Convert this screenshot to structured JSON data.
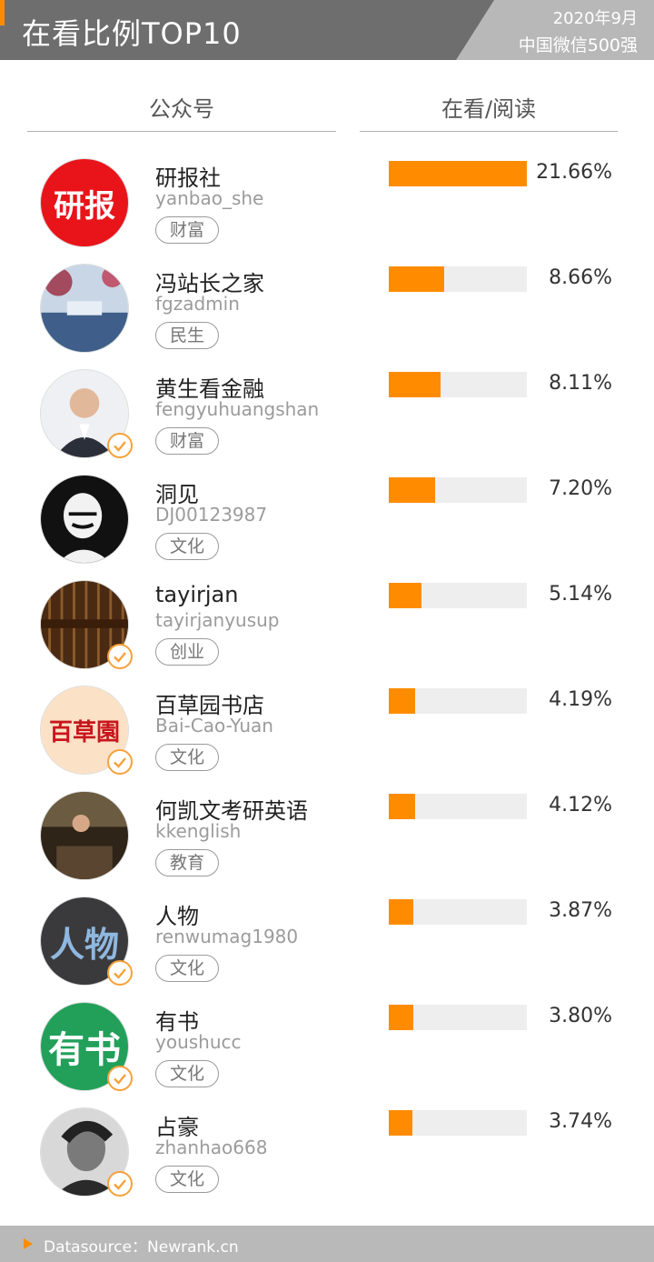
{
  "header": {
    "title": "在看比例TOP10",
    "date": "2020年9月",
    "subtitle": "中国微信500强"
  },
  "columns": {
    "account": "公众号",
    "metric": "在看/阅读"
  },
  "colors": {
    "accent": "#ff8c00",
    "bar_track": "#eeeeee",
    "header_bg": "#6e6e6e",
    "footer_bg": "#b9b9b9"
  },
  "chart_data": {
    "type": "bar",
    "orientation": "horizontal",
    "title": "在看比例TOP10",
    "categories": [
      "研报社",
      "冯站长之家",
      "黄生看金融",
      "洞见",
      "tayirjan",
      "百草园书店",
      "何凯文考研英语",
      "人物",
      "有书",
      "占豪"
    ],
    "values": [
      21.66,
      8.66,
      8.11,
      7.2,
      5.14,
      4.19,
      4.12,
      3.87,
      3.8,
      3.74
    ],
    "value_labels": [
      "21.66%",
      "8.66%",
      "8.11%",
      "7.20%",
      "5.14%",
      "4.19%",
      "4.12%",
      "3.87%",
      "3.80%",
      "3.74%"
    ],
    "xlim": [
      0,
      21.66
    ],
    "grid": false,
    "legend": "none"
  },
  "rows": [
    {
      "name": "研报社",
      "handle": "yanbao_she",
      "tag": "财富",
      "value": "21.66%",
      "verified": false,
      "avatar": "text-logo-icon",
      "avatar_text": "研报"
    },
    {
      "name": "冯站长之家",
      "handle": "fgzadmin",
      "tag": "民生",
      "value": "8.66%",
      "verified": false,
      "avatar": "landscape-photo-icon"
    },
    {
      "name": "黄生看金融",
      "handle": "fengyuhuangshan",
      "tag": "财富",
      "value": "8.11%",
      "verified": true,
      "avatar": "person-portrait-icon"
    },
    {
      "name": "洞见",
      "handle": "DJ00123987",
      "tag": "文化",
      "value": "7.20%",
      "verified": false,
      "avatar": "woodcut-portrait-icon"
    },
    {
      "name": "tayirjan",
      "handle": "tayirjanyusup",
      "tag": "创业",
      "value": "5.14%",
      "verified": true,
      "avatar": "curtain-logo-icon"
    },
    {
      "name": "百草园书店",
      "handle": "Bai-Cao-Yuan",
      "tag": "文化",
      "value": "4.19%",
      "verified": true,
      "avatar": "text-logo-icon",
      "avatar_text": "百草園"
    },
    {
      "name": "何凯文考研英语",
      "handle": "kkenglish",
      "tag": "教育",
      "value": "4.12%",
      "verified": false,
      "avatar": "lecture-photo-icon"
    },
    {
      "name": "人物",
      "handle": "renwumag1980",
      "tag": "文化",
      "value": "3.87%",
      "verified": true,
      "avatar": "text-logo-icon",
      "avatar_text": "人物"
    },
    {
      "name": "有书",
      "handle": "youshucc",
      "tag": "文化",
      "value": "3.80%",
      "verified": true,
      "avatar": "text-logo-icon",
      "avatar_text": "有书"
    },
    {
      "name": "占豪",
      "handle": "zhanhao668",
      "tag": "文化",
      "value": "3.74%",
      "verified": true,
      "avatar": "bw-portrait-icon"
    }
  ],
  "footer": {
    "source": "Datasource：Newrank.cn"
  }
}
